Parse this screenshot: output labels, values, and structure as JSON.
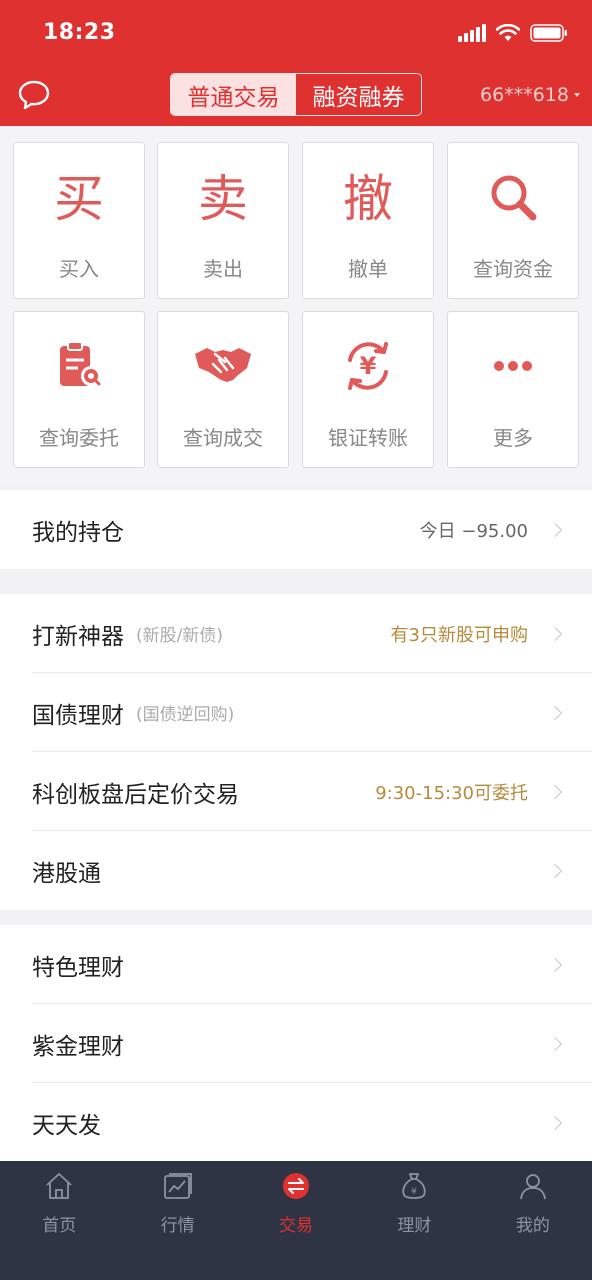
{
  "status_bar": {
    "time": "18:23"
  },
  "header": {
    "segments": [
      "普通交易",
      "融资融券"
    ],
    "account": "66***618"
  },
  "grid": [
    {
      "glyph": "买",
      "label": "买入",
      "icon": "buy-glyph"
    },
    {
      "glyph": "卖",
      "label": "卖出",
      "icon": "sell-glyph"
    },
    {
      "glyph": "撤",
      "label": "撤单",
      "icon": "cancel-glyph"
    },
    {
      "label": "查询资金",
      "icon": "search-icon"
    },
    {
      "label": "查询委托",
      "icon": "clipboard-search-icon"
    },
    {
      "label": "查询成交",
      "icon": "handshake-icon"
    },
    {
      "glyph": "¥",
      "label": "银证转账",
      "icon": "yen-transfer-icon"
    },
    {
      "label": "更多",
      "icon": "more-dots-icon"
    }
  ],
  "holdings": {
    "title": "我的持仓",
    "right": "今日 −95.00"
  },
  "list1": [
    {
      "title": "打新神器",
      "sub": "(新股/新债)",
      "right": "有3只新股可申购"
    },
    {
      "title": "国债理财",
      "sub": "(国债逆回购)",
      "right": ""
    },
    {
      "title": "科创板盘后定价交易",
      "sub": "",
      "right": "9:30-15:30可委托"
    },
    {
      "title": "港股通",
      "sub": "",
      "right": ""
    }
  ],
  "list2": [
    {
      "title": "特色理财"
    },
    {
      "title": "紫金理财"
    },
    {
      "title": "天天发"
    }
  ],
  "tabbar": [
    {
      "label": "首页",
      "icon": "home-icon"
    },
    {
      "label": "行情",
      "icon": "market-chart-icon"
    },
    {
      "label": "交易",
      "icon": "trade-icon"
    },
    {
      "label": "理财",
      "icon": "money-bag-icon"
    },
    {
      "label": "我的",
      "icon": "user-icon"
    }
  ],
  "colors": {
    "brand": "#e03131",
    "icon_red": "#e05a5a",
    "gold": "#b58a3c",
    "tabbar_bg": "#2f3444"
  }
}
